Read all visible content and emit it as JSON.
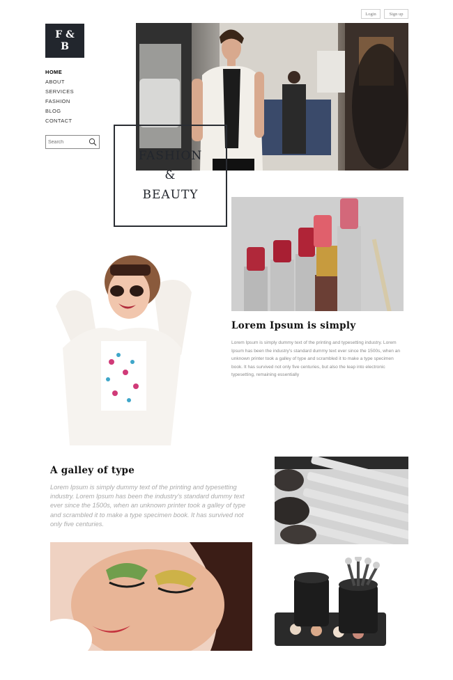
{
  "header": {
    "login_label": "Login",
    "signup_label": "Sign up"
  },
  "logo": {
    "line1": "F &",
    "line2": "B"
  },
  "nav": {
    "items": [
      {
        "label": "HOME"
      },
      {
        "label": "ABOUT"
      },
      {
        "label": "SERVICES"
      },
      {
        "label": "FASHION"
      },
      {
        "label": "BLOG"
      },
      {
        "label": "CONTACT"
      }
    ]
  },
  "search": {
    "placeholder": "Search",
    "icon": "search-icon"
  },
  "hero": {
    "title_line1": "FASHION",
    "title_line2": "&",
    "title_line3": "BEAUTY"
  },
  "section1": {
    "heading": "Lorem Ipsum is simply",
    "body": "Lorem Ipsum is simply dummy text of the printing and typesetting industry. Lorem Ipsum has been the industry's standard dummy text ever since the 1500s, when an unknown printer took a galley of type and scrambled it to make a type specimen book. It has survived not only five centuries, but also the leap into electronic typesetting, remaining essentially"
  },
  "section2": {
    "heading": "A galley of type",
    "body": "Lorem Ipsum is simply dummy text of the printing and typesetting industry. Lorem Ipsum has been the industry's standard dummy text ever since the 1500s, when an unknown printer took a galley of type and scrambled it to make a type specimen book. It has survived not only five centuries."
  },
  "colors": {
    "logo_bg": "#22262d",
    "heading": "#111111",
    "body_text": "#8a8a8a",
    "italic_text": "#a9a9a9"
  }
}
